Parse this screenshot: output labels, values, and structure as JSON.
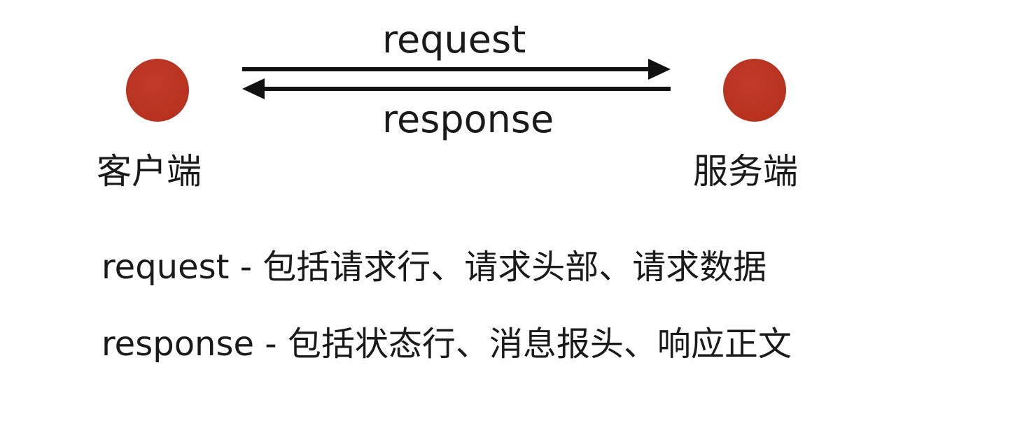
{
  "colors": {
    "node": "#c23b2c",
    "arrow": "#111111",
    "text": "#1a1a1a"
  },
  "nodes": {
    "client": {
      "label": "客户端"
    },
    "server": {
      "label": "服务端"
    }
  },
  "arrows": {
    "request": {
      "label": "request"
    },
    "response": {
      "label": "response"
    }
  },
  "descriptions": {
    "request": "request - 包括请求行、请求头部、请求数据",
    "response": "response - 包括状态行、消息报头、响应正文"
  }
}
